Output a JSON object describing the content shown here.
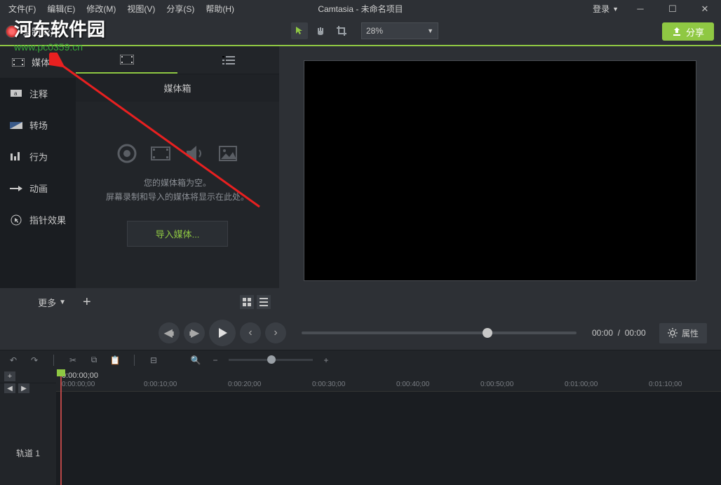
{
  "menu": {
    "file": "文件(F)",
    "edit": "编辑(E)",
    "modify": "修改(M)",
    "view": "视图(V)",
    "share": "分享(S)",
    "help": "帮助(H)"
  },
  "title": "Camtasia - 未命名项目",
  "login": "登录",
  "record": "录制(R)",
  "zoom": "28%",
  "share_btn": "分享",
  "sidebar": {
    "media": "媒体",
    "annotation": "注释",
    "transition": "转场",
    "behavior": "行为",
    "animation": "动画",
    "cursor": "指针效果",
    "more": "更多"
  },
  "media_panel": {
    "header": "媒体箱",
    "empty1": "您的媒体箱为空。",
    "empty2": "屏幕录制和导入的媒体将显示在此处。",
    "import": "导入媒体..."
  },
  "playback": {
    "current": "00:00",
    "sep": "/",
    "total": "00:00",
    "properties": "属性"
  },
  "timeline": {
    "timecode": "0:00:00;00",
    "ticks": [
      "0:00:00;00",
      "0:00:10;00",
      "0:00:20;00",
      "0:00:30;00",
      "0:00:40;00",
      "0:00:50;00",
      "0:01:00;00",
      "0:01:10;00"
    ],
    "track1": "轨道 1"
  },
  "watermark": {
    "line1": "河东软件园",
    "line2": "www.pc0359.cn"
  }
}
